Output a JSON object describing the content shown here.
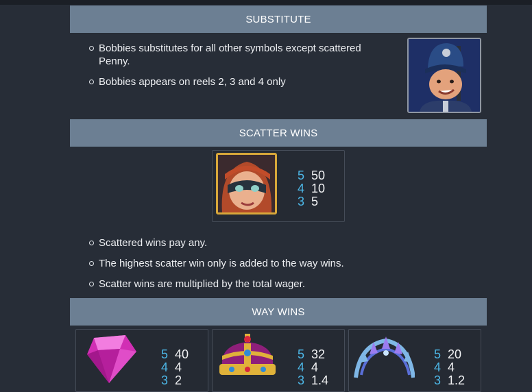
{
  "substitute": {
    "title": "SUBSTITUTE",
    "bullets": [
      "Bobbies substitutes for all other symbols except scattered Penny.",
      "Bobbies appears on reels 2, 3 and 4 only"
    ],
    "symbol_icon": "police-officer-icon"
  },
  "scatter": {
    "title": "SCATTER WINS",
    "symbol_icon": "masked-woman-penny-icon",
    "pays": [
      {
        "count": "5",
        "value": "50"
      },
      {
        "count": "4",
        "value": "10"
      },
      {
        "count": "3",
        "value": "5"
      }
    ],
    "bullets": [
      "Scattered wins pay any.",
      "The highest scatter win only is added to the way wins.",
      "Scatter wins are multiplied by the total wager."
    ]
  },
  "way_wins": {
    "title": "WAY WINS",
    "symbols": [
      {
        "icon": "pink-gem-icon",
        "pays": [
          {
            "count": "5",
            "value": "40"
          },
          {
            "count": "4",
            "value": "4"
          },
          {
            "count": "3",
            "value": "2"
          }
        ]
      },
      {
        "icon": "crown-icon",
        "pays": [
          {
            "count": "5",
            "value": "32"
          },
          {
            "count": "4",
            "value": "4"
          },
          {
            "count": "3",
            "value": "1.4"
          }
        ]
      },
      {
        "icon": "tiara-icon",
        "pays": [
          {
            "count": "5",
            "value": "20"
          },
          {
            "count": "4",
            "value": "4"
          },
          {
            "count": "3",
            "value": "1.2"
          }
        ]
      }
    ]
  },
  "colors": {
    "background": "#272d37",
    "header": "#6c7f93",
    "pay_count": "#4db8e8"
  }
}
